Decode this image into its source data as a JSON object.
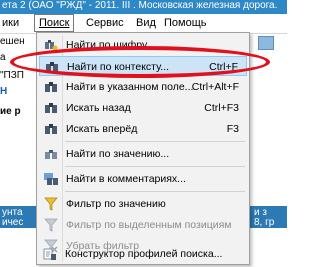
{
  "window": {
    "title_fragment": "ета 2 (ОАО \"РЖД\" - 2011. III . Московская железная дорога."
  },
  "menubar": {
    "items": [
      {
        "label": "ики"
      },
      {
        "label": "Поиск"
      },
      {
        "label": "Сервис"
      },
      {
        "label": "Вид"
      },
      {
        "label": "Помощь"
      }
    ]
  },
  "background": {
    "left_fragments": [
      "ешен",
      "а",
      "\"ПЗП",
      "Н",
      "ие р",
      "унта",
      "ичес"
    ],
    "right_fragments": [
      "и з",
      "8, гр"
    ]
  },
  "menu": {
    "items": [
      {
        "label": "Найти по шифру...",
        "shortcut": "",
        "icon": "binoculars-key-icon",
        "state": "normal"
      },
      {
        "label": "Найти по контексту...",
        "shortcut": "Ctrl+F",
        "icon": "binoculars-icon",
        "state": "highlighted"
      },
      {
        "label": "Найти в указанном поле...",
        "shortcut": "Ctrl+Alt+F",
        "icon": "binoculars-field-icon",
        "state": "normal"
      },
      {
        "label": "Искать назад",
        "shortcut": "Ctrl+F3",
        "icon": "binoculars-back-icon",
        "state": "normal"
      },
      {
        "label": "Искать вперёд",
        "shortcut": "F3",
        "icon": "binoculars-forward-icon",
        "state": "normal"
      },
      {
        "label": "Найти по значению...",
        "shortcut": "",
        "icon": "binoculars-value-icon",
        "state": "normal"
      },
      {
        "label": "Найти в комментариях...",
        "shortcut": "",
        "icon": "binoculars-comment-icon",
        "state": "normal"
      },
      {
        "label": "Фильтр по значению",
        "shortcut": "",
        "icon": "funnel-icon",
        "state": "normal"
      },
      {
        "label": "Фильтр по выделенным позициям",
        "shortcut": "",
        "icon": "funnel-selection-icon",
        "state": "disabled"
      },
      {
        "label": "Убрать фильтр",
        "shortcut": "",
        "icon": "funnel-remove-icon",
        "state": "disabled"
      },
      {
        "label": "Конструктор профилей поиска...",
        "shortcut": "",
        "icon": "search-profile-icon",
        "state": "normal"
      }
    ]
  },
  "colors": {
    "highlight_bg": "#cde4f7",
    "highlight_border": "#90c8f6",
    "annotation_oval": "#e0101c",
    "titlebar": "#2e88c6"
  }
}
